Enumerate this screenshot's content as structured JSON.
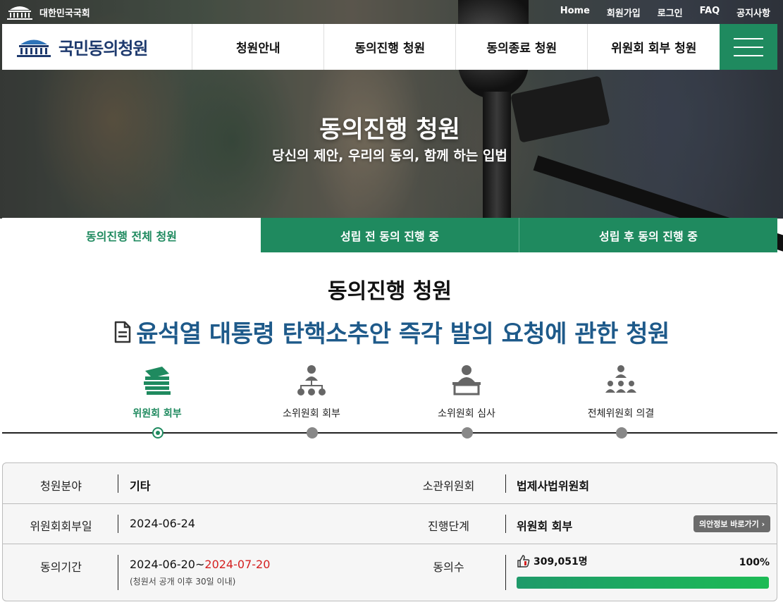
{
  "topbar": {
    "org_name": "대한민국국회",
    "links": [
      "Home",
      "회원가입",
      "로그인",
      "FAQ",
      "공지사항"
    ]
  },
  "nav": {
    "logo_text": "국민동의청원",
    "items": [
      "청원안내",
      "동의진행 청원",
      "동의종료 청원",
      "위원회 회부 청원"
    ]
  },
  "hero": {
    "title": "동의진행 청원",
    "subtitle": "당신의 제안, 우리의 동의, 함께 하는 입법"
  },
  "tabs": [
    "동의진행 전체 청원",
    "성립 전 동의 진행 중",
    "성립 후 동의 진행 중"
  ],
  "section_title": "동의진행 청원",
  "petition_title": "윤석열 대통령 탄핵소추안 즉각 발의 요청에 관한 청원",
  "steps": [
    {
      "label": "위원회 회부",
      "icon": "documents-icon",
      "active": true
    },
    {
      "label": "소위원회 회부",
      "icon": "org-chart-icon",
      "active": false
    },
    {
      "label": "소위원회 심사",
      "icon": "podium-icon",
      "active": false
    },
    {
      "label": "전체위원회 의결",
      "icon": "assembly-icon",
      "active": false
    }
  ],
  "info": {
    "field_label": "청원분야",
    "field_value": "기타",
    "committee_label": "소관위원회",
    "committee_value": "법제사법위원회",
    "refer_date_label": "위원회회부일",
    "refer_date_value": "2024-06-24",
    "stage_label": "진행단계",
    "stage_value": "위원회 회부",
    "bill_info_button": "의안정보 바로가기",
    "period_label": "동의기간",
    "period_start": "2024-06-20~",
    "period_end": "2024-07-20",
    "period_note": "(청원서 공개 이후 30일 이내)",
    "count_label": "동의수",
    "count_value": "309,051명",
    "percent_label": "100%",
    "progress": 1.0
  },
  "colors": {
    "accent": "#1f8a5f",
    "title_blue": "#1e5a8a",
    "deadline_red": "#d42020"
  }
}
